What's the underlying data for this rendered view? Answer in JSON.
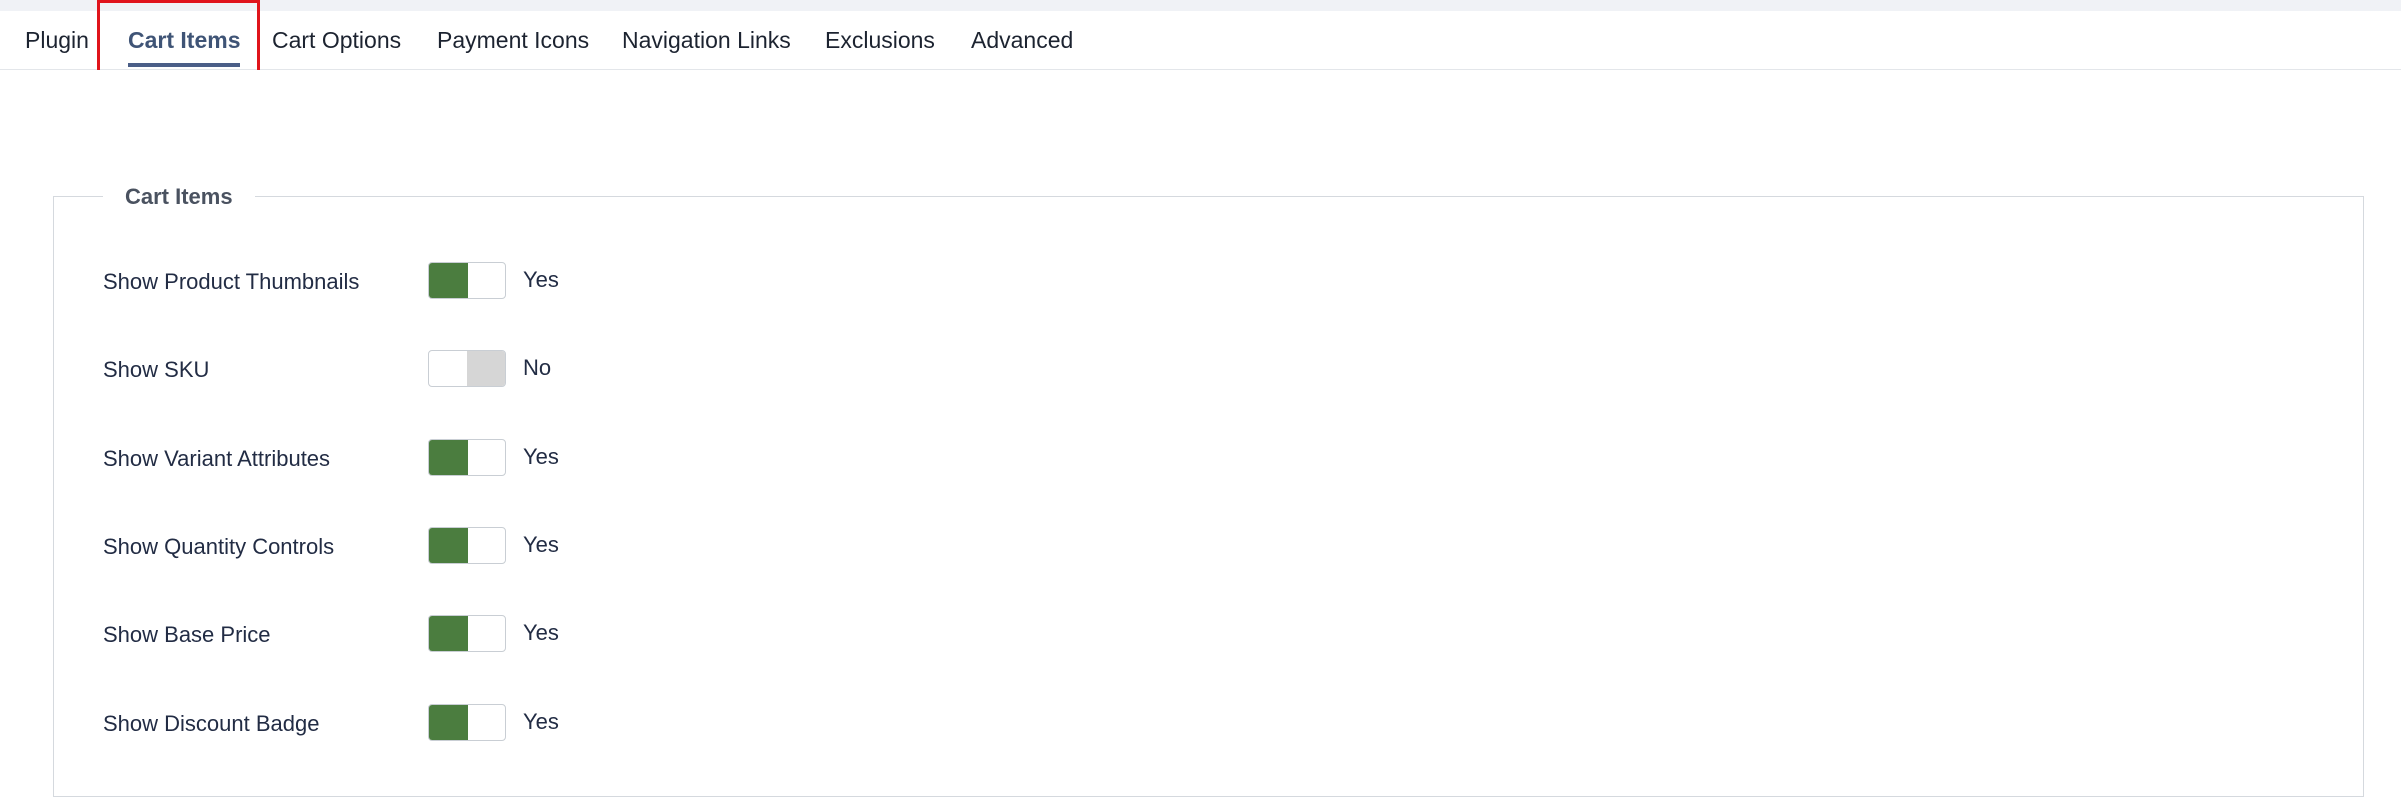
{
  "tabs": [
    {
      "label": "Plugin"
    },
    {
      "label": "Cart Items"
    },
    {
      "label": "Cart Options"
    },
    {
      "label": "Payment Icons"
    },
    {
      "label": "Navigation Links"
    },
    {
      "label": "Exclusions"
    },
    {
      "label": "Advanced"
    }
  ],
  "active_tab": "Cart Items",
  "fieldset": {
    "legend": "Cart Items",
    "rows": [
      {
        "label": "Show Product Thumbnails",
        "state": "Yes"
      },
      {
        "label": "Show SKU",
        "state": "No"
      },
      {
        "label": "Show Variant Attributes",
        "state": "Yes"
      },
      {
        "label": "Show Quantity Controls",
        "state": "Yes"
      },
      {
        "label": "Show Base Price",
        "state": "Yes"
      },
      {
        "label": "Show Discount Badge",
        "state": "Yes"
      }
    ]
  },
  "colors": {
    "switch_on": "#4b7d3f",
    "switch_off": "#d6d6d6",
    "active_tab": "#3f5476",
    "highlight_box": "#e0141b"
  }
}
